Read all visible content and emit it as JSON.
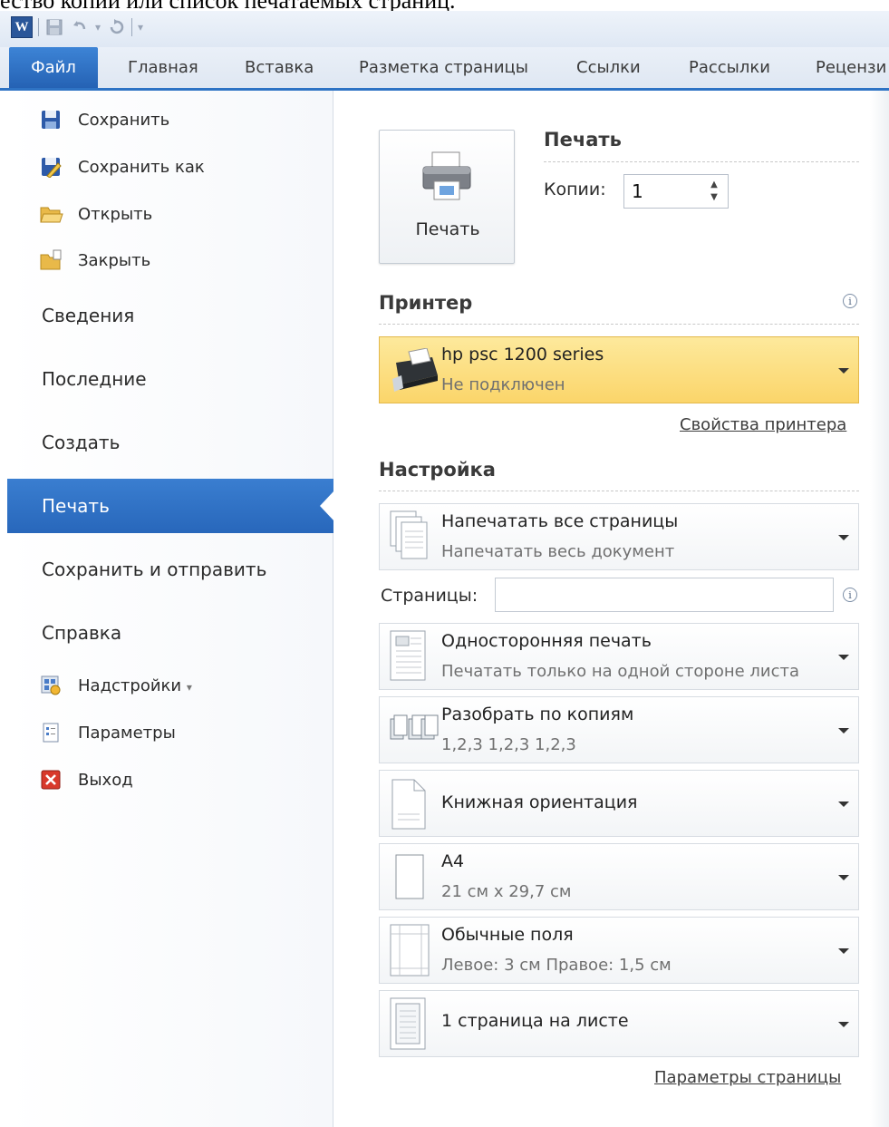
{
  "top_text": "ество копий или список печатаемых страниц.",
  "qat": {
    "logo": "W"
  },
  "tabs": [
    {
      "label": "Файл",
      "active": true
    },
    {
      "label": "Главная"
    },
    {
      "label": "Вставка"
    },
    {
      "label": "Разметка страницы"
    },
    {
      "label": "Ссылки"
    },
    {
      "label": "Рассылки"
    },
    {
      "label": "Рецензи"
    }
  ],
  "left_menu": {
    "save": "Сохранить",
    "save_as": "Сохранить как",
    "open": "Открыть",
    "close": "Закрыть",
    "info": "Сведения",
    "recent": "Последние",
    "new": "Создать",
    "print": "Печать",
    "save_send": "Сохранить и отправить",
    "help": "Справка",
    "addins": "Надстройки",
    "addins_arrow": "▾",
    "options": "Параметры",
    "exit": "Выход"
  },
  "print": {
    "button_label": "Печать",
    "section_title": "Печать",
    "copies_label": "Копии:",
    "copies_value": "1"
  },
  "printer": {
    "section_title": "Принтер",
    "name": "hp psc 1200 series",
    "status": "Не подключен",
    "properties_link": "Свойства принтера"
  },
  "settings": {
    "section_title": "Настройка",
    "pages_label": "Страницы:",
    "pages_value": "",
    "items": [
      {
        "main": "Напечатать все страницы",
        "sub": "Напечатать весь документ"
      },
      {
        "main": "Односторонняя печать",
        "sub": "Печатать только на одной стороне листа"
      },
      {
        "main": "Разобрать по копиям",
        "sub": "1,2,3   1,2,3   1,2,3"
      },
      {
        "main": "Книжная ориентация",
        "sub": ""
      },
      {
        "main": "А4",
        "sub": "21 см x 29,7 см"
      },
      {
        "main": "Обычные поля",
        "sub": "Левое: 3 см   Правое: 1,5 см"
      },
      {
        "main": "1 страница на листе",
        "sub": ""
      }
    ],
    "page_setup_link": "Параметры страницы"
  },
  "colors": {
    "accent": "#2e73c4",
    "printer_highlight": "#fbd56a"
  }
}
